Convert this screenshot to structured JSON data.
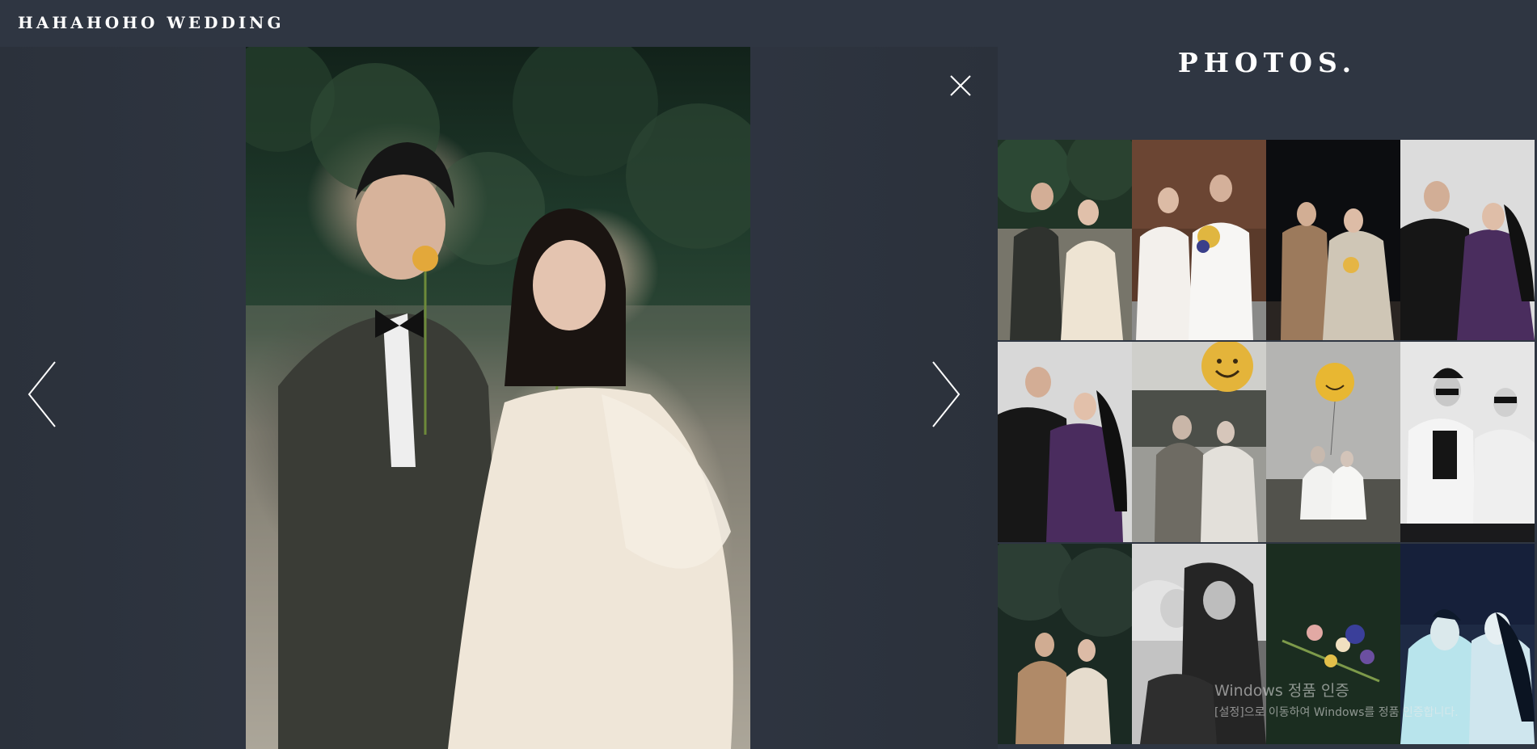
{
  "header": {
    "brand": "HAHAHOHO WEDDING"
  },
  "viewer": {
    "prev_icon": "chevron-left-icon",
    "next_icon": "chevron-right-icon",
    "close_icon": "close-icon"
  },
  "gallery": {
    "title": "PHOTOS.",
    "thumbnails": [
      {
        "row": 0,
        "col": 0,
        "tone": "color"
      },
      {
        "row": 0,
        "col": 1,
        "tone": "color"
      },
      {
        "row": 0,
        "col": 2,
        "tone": "color"
      },
      {
        "row": 0,
        "col": 3,
        "tone": "color"
      },
      {
        "row": 1,
        "col": 0,
        "tone": "color"
      },
      {
        "row": 1,
        "col": 1,
        "tone": "color"
      },
      {
        "row": 1,
        "col": 2,
        "tone": "color"
      },
      {
        "row": 1,
        "col": 3,
        "tone": "bw"
      },
      {
        "row": 2,
        "col": 0,
        "tone": "color"
      },
      {
        "row": 2,
        "col": 1,
        "tone": "bw"
      },
      {
        "row": 2,
        "col": 2,
        "tone": "color"
      },
      {
        "row": 2,
        "col": 3,
        "tone": "color"
      }
    ]
  },
  "system_watermark": {
    "line1": "Windows 정품 인증",
    "line2": "[설정]으로 이동하여 Windows를 정품 인증합니다."
  },
  "colors": {
    "background": "#2f3642",
    "text": "#ffffff",
    "icon": "#ffffff"
  }
}
